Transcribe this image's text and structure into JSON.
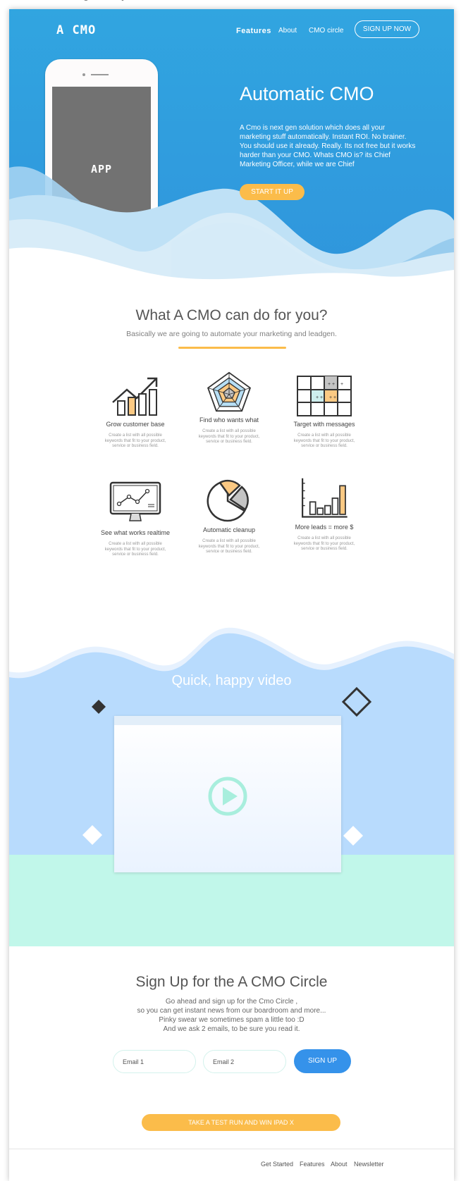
{
  "header": {
    "logo": "A CMO",
    "nav": {
      "features": "Features",
      "about": "About",
      "circle": "CMO circle"
    },
    "signup_label": "SIGN UP NOW"
  },
  "hero": {
    "title": "Automatic CMO",
    "text": "A Cmo is next gen solution which does all your marketing stuff automatically. Instant ROI. No brainer. You should use it already. Really. Its not free but it works harder than your CMO. Whats CMO is? its Chief Marketing Officer, while we are Chief",
    "cta": "START IT UP",
    "phone_label": "APP"
  },
  "features": {
    "title": "What A CMO can do for you?",
    "subtitle": "Basically we are going to automate your marketing and leadgen.",
    "items": [
      {
        "title": "Grow customer base",
        "desc": "Create a list with all possible keywords that fit to your product, service or business field.",
        "icon": "growth-chart-icon"
      },
      {
        "title": "Find who wants what",
        "desc": "Create a list with all possible keywords that fit to your product, service or business field.",
        "icon": "radar-chart-icon"
      },
      {
        "title": "Target with messages",
        "desc": "Create a list with all possible keywords that fit to your product, service or business field.",
        "icon": "target-grid-icon"
      },
      {
        "title": "See what works realtime",
        "desc": "Create a list with all possible keywords that fit to your product, service or business field.",
        "icon": "monitor-chart-icon"
      },
      {
        "title": "Automatic cleanup",
        "desc": "Create a list with all possible keywords that fit to your product, service or business field.",
        "icon": "pie-chart-icon"
      },
      {
        "title": "More leads = more $",
        "desc": "Create a list with all possible keywords that fit to your product, service or business field.",
        "icon": "bar-chart-icon"
      }
    ]
  },
  "video": {
    "title": "Quick, happy video",
    "icon": "play-icon"
  },
  "signup": {
    "title": "Sign Up for the A CMO Circle",
    "lines": [
      "Go ahead and sign up for the Cmo Circle ,",
      "so you can get instant news from our boardroom and more...",
      "Pinky swear we sometimes spam a little too :D",
      "And we ask 2 emails, to be sure you read it."
    ],
    "email1_placeholder": "Email 1",
    "email2_placeholder": "Email 2",
    "submit": "SIGN UP"
  },
  "cta": {
    "testrun": "TAKE A TEST RUN AND WIN IPAD X"
  },
  "footer": {
    "links": [
      "Get Started",
      "Features",
      "About",
      "Newsletter"
    ]
  },
  "colors": {
    "hero_blue": "#31a5e0",
    "accent_orange": "#fbbc4a",
    "button_blue": "#3592ea",
    "video_bg": "#b8dbfd",
    "mint": "#c1f7ea"
  }
}
